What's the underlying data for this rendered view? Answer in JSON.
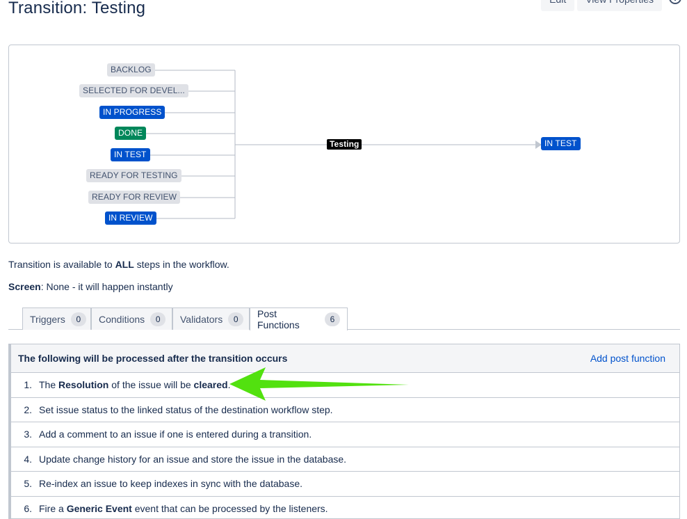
{
  "header": {
    "title": "Transition: Testing",
    "edit_label": "Edit",
    "view_properties_label": "View Properties"
  },
  "diagram": {
    "source_statuses": [
      {
        "label": "BACKLOG",
        "category": "todo"
      },
      {
        "label": "SELECTED FOR DEVEL...",
        "category": "todo"
      },
      {
        "label": "IN PROGRESS",
        "category": "inprogress"
      },
      {
        "label": "DONE",
        "category": "done"
      },
      {
        "label": "IN TEST",
        "category": "inprogress"
      },
      {
        "label": "READY FOR TESTING",
        "category": "todo"
      },
      {
        "label": "READY FOR REVIEW",
        "category": "todo"
      },
      {
        "label": "IN REVIEW",
        "category": "inprogress"
      }
    ],
    "transition_label": "Testing",
    "target_status": {
      "label": "IN TEST",
      "category": "inprogress"
    }
  },
  "info": {
    "availability_pre": "Transition is available to ",
    "availability_bold": "ALL",
    "availability_post": " steps in the workflow.",
    "screen_label": "Screen",
    "screen_value": ": None - it will happen instantly"
  },
  "tabs": [
    {
      "label": "Triggers",
      "count": "0"
    },
    {
      "label": "Conditions",
      "count": "0"
    },
    {
      "label": "Validators",
      "count": "0"
    },
    {
      "label": "Post Functions",
      "count": "6"
    }
  ],
  "post_functions": {
    "header": "The following will be processed after the transition occurs",
    "add_label": "Add post function",
    "items": [
      {
        "num": "1.",
        "parts": [
          {
            "t": "The "
          },
          {
            "t": "Resolution",
            "b": true
          },
          {
            "t": " of the issue will be "
          },
          {
            "t": "cleared",
            "b": true
          },
          {
            "t": "."
          }
        ]
      },
      {
        "num": "2.",
        "parts": [
          {
            "t": "Set issue status to the linked status of the destination workflow step."
          }
        ]
      },
      {
        "num": "3.",
        "parts": [
          {
            "t": "Add a comment to an issue if one is entered during a transition."
          }
        ]
      },
      {
        "num": "4.",
        "parts": [
          {
            "t": "Update change history for an issue and store the issue in the database."
          }
        ]
      },
      {
        "num": "5.",
        "parts": [
          {
            "t": "Re-index an issue to keep indexes in sync with the database."
          }
        ]
      },
      {
        "num": "6.",
        "parts": [
          {
            "t": "Fire a "
          },
          {
            "t": "Generic Event",
            "b": true
          },
          {
            "t": " event that can be processed by the listeners."
          }
        ]
      }
    ]
  },
  "colors": {
    "todo": "#dfe1e6",
    "inprogress": "#0052cc",
    "done": "#00875a",
    "annotation_arrow": "#52e10f"
  }
}
